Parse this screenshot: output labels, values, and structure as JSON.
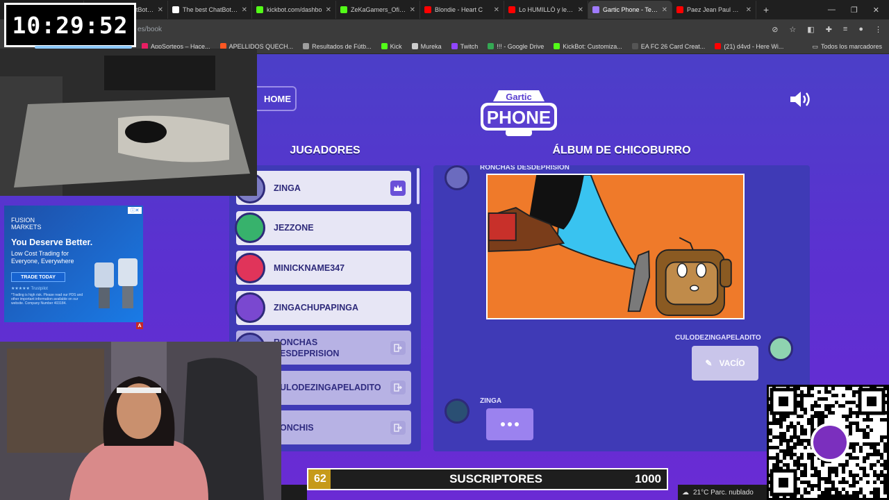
{
  "browser": {
    "tabs": [
      {
        "label": "Stream - Kick Dashb",
        "color": "#53fc18"
      },
      {
        "label": "The best ChatBot and",
        "color": "#ffffff"
      },
      {
        "label": "The best ChatBot and",
        "color": "#ffffff"
      },
      {
        "label": "kickbot.com/dashbo",
        "color": "#53fc18"
      },
      {
        "label": "ZeKaGamers_Oficial",
        "color": "#53fc18"
      },
      {
        "label": "Blondie - Heart C",
        "color": "#ff0000"
      },
      {
        "label": "Lo HUMILLÓ y le pus",
        "color": "#ff0000"
      },
      {
        "label": "Gartic Phone - Teléfo",
        "color": "#a07bff"
      },
      {
        "label": "Paez Jean Paul @ M",
        "color": "#ff0000"
      }
    ],
    "active_tab": 7,
    "url": "es/book",
    "bookmarks": [
      {
        "label": "AppSorteos – Hace...",
        "color": "#e91e63"
      },
      {
        "label": "APELLIDOS QUECH...",
        "color": "#ff5722"
      },
      {
        "label": "Resultados de Fútb...",
        "color": "#9e9e9e"
      },
      {
        "label": "Kick",
        "color": "#53fc18"
      },
      {
        "label": "Mureka",
        "color": "#cccccc"
      },
      {
        "label": "Twitch",
        "color": "#9146ff"
      },
      {
        "label": "!!! - Google Drive",
        "color": "#34a853"
      },
      {
        "label": "KickBot: Customiza...",
        "color": "#53fc18"
      },
      {
        "label": "EA FC 26 Card Creat...",
        "color": "#555555"
      },
      {
        "label": "(21) d4vd - Here Wi...",
        "color": "#ff0000"
      }
    ],
    "all_bookmarks": "Todos los marcadores"
  },
  "game": {
    "home_label": "HOME",
    "logo_top": "Gartic",
    "logo_bottom": "PHONE",
    "players_heading": "JUGADORES",
    "album_heading": "ÁLBUM DE CHICOBURRO",
    "players": [
      {
        "name": "ZINGA",
        "avatar_color": "#7c7cc4",
        "host": true,
        "dim": false
      },
      {
        "name": "JEZZONE",
        "avatar_color": "#37b26c",
        "host": false,
        "dim": false
      },
      {
        "name": "MINICKNAME347",
        "avatar_color": "#e0345a",
        "host": false,
        "dim": false
      },
      {
        "name": "ZINGACHUPAPINGA",
        "avatar_color": "#7a48d0",
        "host": false,
        "dim": false
      },
      {
        "name": "RONCHAS DESDEPRISION",
        "avatar_color": "#6b6bbf",
        "host": false,
        "dim": true
      },
      {
        "name": "CULODEZINGAPELADITO",
        "avatar_color": "#6b6bbf",
        "host": false,
        "dim": true
      },
      {
        "name": "RONCHIS",
        "avatar_color": "#6b6bbf",
        "host": false,
        "dim": true
      }
    ],
    "album": {
      "drawer": "RONCHAS DESDEPRISION",
      "responder": "CULODEZINGAPELADITO",
      "empty_label": "VACÍO",
      "waiting_player": "ZINGA"
    }
  },
  "overlay": {
    "clock": "10:29:52",
    "ad": {
      "brand_line1": "FUSION",
      "brand_line2": "MARKETS",
      "headline": "You Deserve Better.",
      "subtext": "Low Cost Trading for Everyone, Everywhere",
      "cta": "TRADE TODAY",
      "rating": "★★★★★ Trustpilot",
      "disclaimer": "*Trading is high risk. Please read our PDS and other important information available on our website. Company Number 403184.",
      "badge": "A"
    },
    "subs": {
      "current": "62",
      "label": "SUSCRIPTORES",
      "goal": "1000",
      "progress": 0.062
    },
    "weather": "21°C Parc. nublado"
  }
}
